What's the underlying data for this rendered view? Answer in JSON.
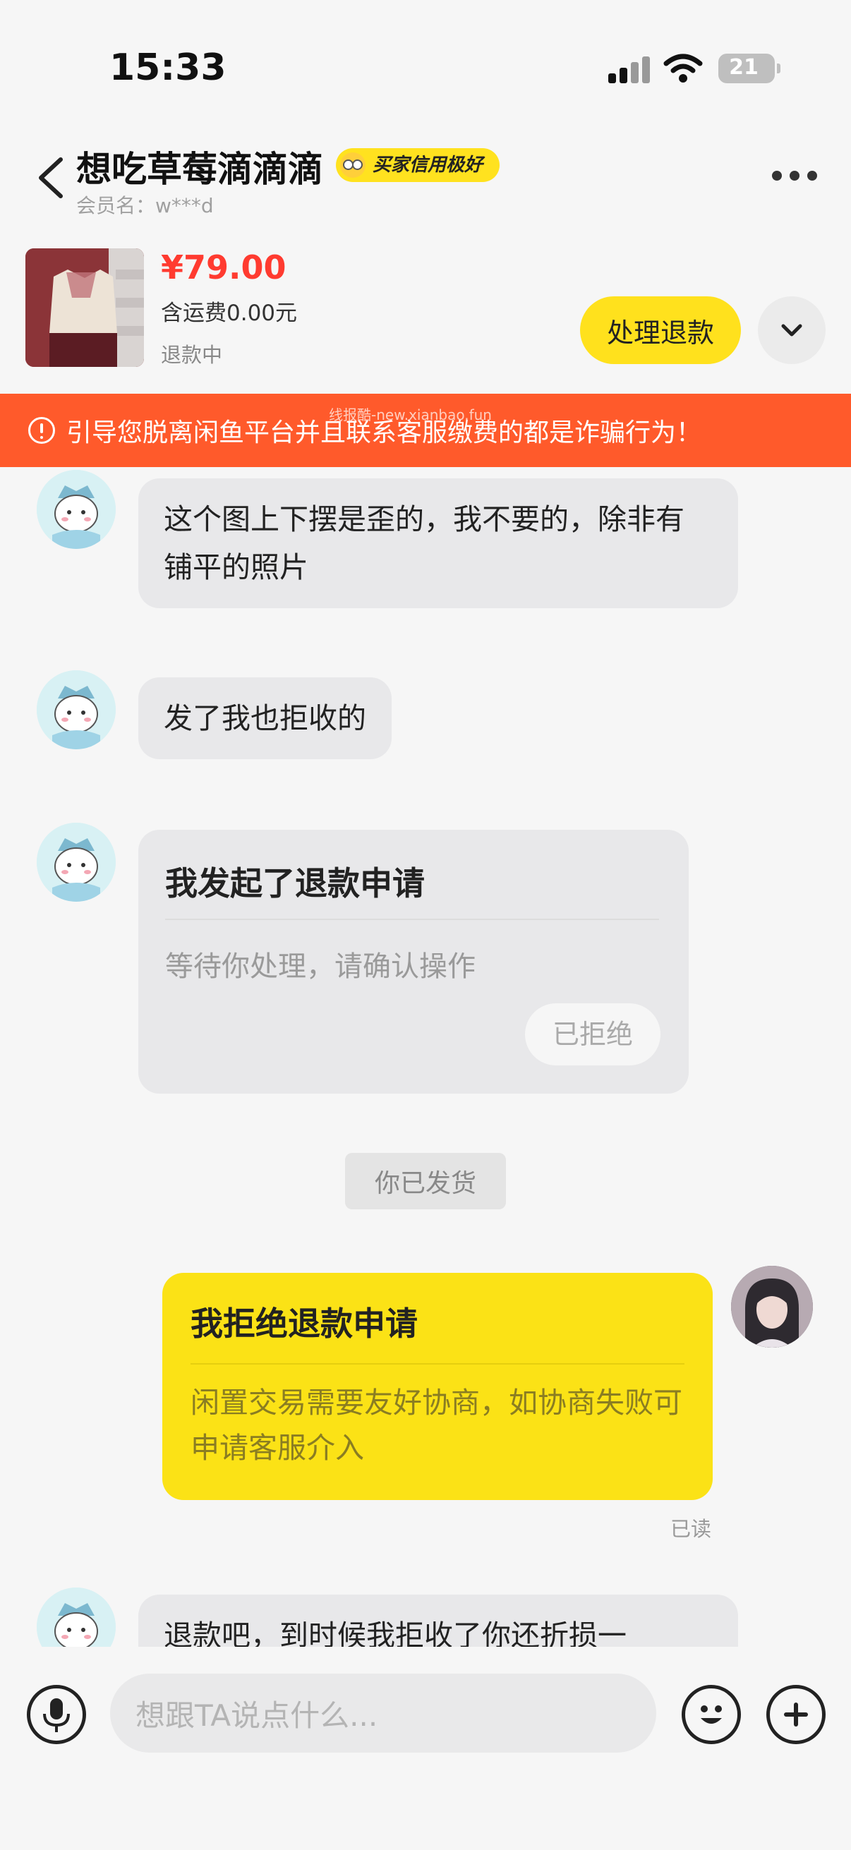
{
  "status_bar": {
    "time": "15:33",
    "battery": "21"
  },
  "header": {
    "title": "想吃草莓滴滴滴",
    "credit_badge": "买家信用极好",
    "member_label": "会员名：w***d"
  },
  "product": {
    "price": "¥79.00",
    "shipping": "含运费0.00元",
    "status": "退款中",
    "action_button": "处理退款"
  },
  "warning": {
    "text": "引导您脱离闲鱼平台并且联系客服缴费的都是诈骗行为！",
    "watermark": "线报酷-new.xianbao.fun"
  },
  "messages": {
    "msg1": "这个图上下摆是歪的，我不要的，除非有铺平的照片",
    "msg2": "发了我也拒收的",
    "refund_card": {
      "title": "我发起了退款申请",
      "subtitle": "等待你处理，请确认操作",
      "status_button": "已拒绝"
    },
    "system_notice": "你已发货",
    "my_card": {
      "title": "我拒绝退款申请",
      "body": "闲置交易需要友好协商，如协商失败可申请客服介入"
    },
    "read_receipt": "已读",
    "msg_last": "退款吧，到时候我拒收了你还折损一"
  },
  "input_bar": {
    "placeholder": "想跟TA说点什么..."
  },
  "colors": {
    "accent_yellow": "#ffe11d",
    "price_red": "#ff3b30",
    "warning_orange": "#ff5a2b"
  },
  "icons": [
    "back-icon",
    "more-icon",
    "chevron-down-icon",
    "warning-icon",
    "microphone-icon",
    "emoji-icon",
    "plus-icon",
    "signal-icon",
    "wifi-icon",
    "battery-icon"
  ]
}
